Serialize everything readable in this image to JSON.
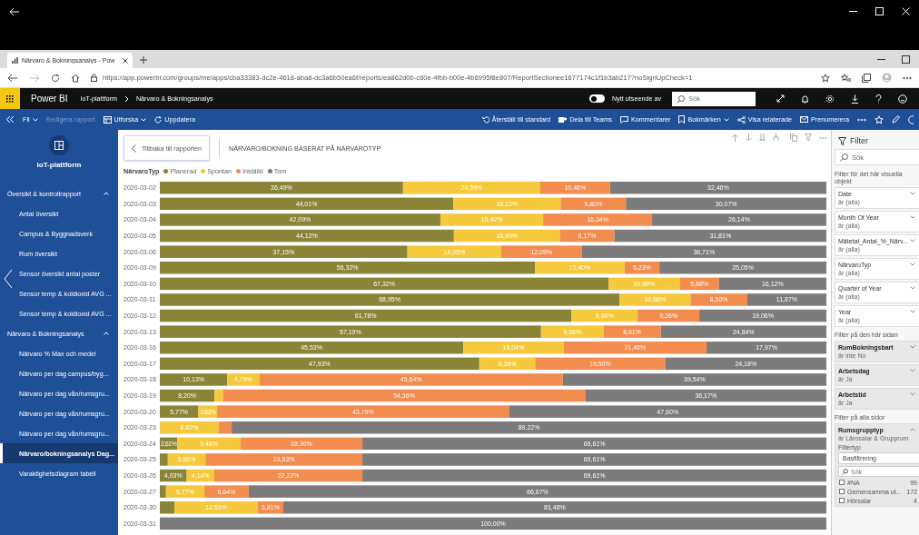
{
  "browser": {
    "tab": {
      "title": "Närvaro & Bokningsanalys - Pow"
    },
    "url": "https://app.powerbi.com/groups/me/apps/cba33383-dc2e-4618-aba8-dc3a6b50ea6f/reports/ea862d0b-c60e-4fbb-b00e-4b6995f8e807/ReportSectionee1677174c1f1b3ab217?noSignUpCheck=1"
  },
  "app_header": {
    "product": "Power BI",
    "breadcrumb": [
      "IoT-plattform",
      "Närvaro & Bokningsanalys"
    ],
    "toggle": {
      "label": "Nytt utseende av",
      "on": false
    },
    "search": {
      "placeholder": "Sök"
    }
  },
  "action_bar": {
    "left": [
      {
        "label": "Fil",
        "kind": "menu",
        "disabled": false
      },
      {
        "label": "Redigera rapport",
        "kind": "button",
        "disabled": true
      },
      {
        "label": "Utforska",
        "kind": "menu",
        "disabled": false
      },
      {
        "label": "Uppdatera",
        "kind": "button",
        "disabled": false
      }
    ],
    "right": [
      {
        "label": "Återställ till standard",
        "kind": "button",
        "disabled": false
      },
      {
        "label": "Dela till Teams",
        "kind": "button",
        "disabled": false
      },
      {
        "label": "Kommentarer",
        "kind": "button",
        "disabled": false
      },
      {
        "label": "Bokmärken",
        "kind": "menu",
        "disabled": false
      },
      {
        "label": "Visa relaterade",
        "kind": "button",
        "disabled": false
      },
      {
        "label": "Prenumerera",
        "kind": "button",
        "disabled": false
      }
    ]
  },
  "sidebar": {
    "workspace": "IoT-plattform",
    "sections": [
      {
        "title": "Översikt & kontrollrapport",
        "expanded": true,
        "children": [
          {
            "label": "Antal översikt",
            "selected": false
          },
          {
            "label": "Campus & Byggnadsverk",
            "selected": false
          },
          {
            "label": "Rum översikt",
            "selected": false
          },
          {
            "label": "Sensor översikt antal poster",
            "selected": false
          },
          {
            "label": "Sensor temp & koldioxid AVG ...",
            "selected": false
          },
          {
            "label": "Sensor temp & koldioxid AVG ...",
            "selected": false
          }
        ]
      },
      {
        "title": "Närvaro & Bokningsanalys",
        "expanded": true,
        "children": [
          {
            "label": "Närvaro % Max och medel",
            "selected": false
          },
          {
            "label": "Närvaro per dag campus/byg...",
            "selected": false
          },
          {
            "label": "Närvaro per dag vån/rumsgru...",
            "selected": false
          },
          {
            "label": "Närvaro per dag vån/rumsgru...",
            "selected": false
          },
          {
            "label": "Närvaro per dag vån/rumsgru...",
            "selected": false
          },
          {
            "label": "Närvaro/bokningsanalys Dag...",
            "selected": true
          },
          {
            "label": "Varaktighetsdiagram tabell",
            "selected": false
          }
        ]
      }
    ]
  },
  "report": {
    "back_button": "Tillbaka till rapporten",
    "legend_title": "NärvaroTyp",
    "chart_data": {
      "type": "bar",
      "orientation": "horizontal",
      "stacked": true,
      "title": "NÄRVARO/BOKNING BASERAT PÅ NÄRVAROTYP",
      "categories": [
        "2020-03-02",
        "2020-03-03",
        "2020-03-04",
        "2020-03-05",
        "2020-03-06",
        "2020-03-09",
        "2020-03-10",
        "2020-03-11",
        "2020-03-12",
        "2020-03-13",
        "2020-03-16",
        "2020-03-17",
        "2020-03-18",
        "2020-03-19",
        "2020-03-20",
        "2020-03-23",
        "2020-03-24",
        "2020-03-25",
        "2020-03-26",
        "2020-03-27",
        "2020-03-30",
        "2020-03-31"
      ],
      "series": [
        {
          "name": "Planerad",
          "color": "#8a8436",
          "values": [
            36.49,
            44.01,
            42.09,
            44.12,
            37.15,
            56.32,
            67.32,
            68.95,
            61.78,
            57.19,
            45.53,
            47.93,
            10.13,
            8.2,
            5.77,
            0,
            2.61,
            1.2,
            4.03,
            0.92,
            2.18,
            0
          ],
          "value_labels": [
            "36,49%",
            "44,01%",
            "42,09%",
            "44,12%",
            "37,15%",
            "56,32%",
            "67,32%",
            "68,95%",
            "61,78%",
            "57,19%",
            "45,53%",
            "47,93%",
            "10,13%",
            "8,20%",
            "5,77%",
            null,
            "2,61%",
            null,
            "4,03%",
            null,
            null,
            null
          ]
        },
        {
          "name": "Spontan",
          "color": "#f5c93b",
          "values": [
            20.59,
            16.12,
            15.42,
            15.9,
            14.05,
            13.4,
            10.68,
            10.68,
            9.9,
            9.36,
            15.04,
            8.39,
            4.79,
            1.27,
            2.83,
            8.82,
            9.48,
            5.66,
            4.14,
            5.77,
            12.53,
            0
          ],
          "value_labels": [
            "20,59%",
            "16,12%",
            "15,42%",
            "15,90%",
            "14,05%",
            "13,40%",
            "10,68%",
            "10,68%",
            "9,90%",
            "9,36%",
            "15,04%",
            "8,39%",
            "4,79%",
            null,
            "2,83%",
            "8,82%",
            "9,48%",
            "5,66%",
            "4,14%",
            "5,77%",
            "12,53%",
            null
          ]
        },
        {
          "name": "Inställd",
          "color": "#f28c4f",
          "values": [
            10.46,
            9.8,
            16.34,
            8.17,
            12.09,
            5.23,
            5.88,
            8.5,
            9.26,
            8.61,
            21.46,
            19.5,
            45.54,
            54.36,
            43.79,
            1.96,
            18.3,
            23.53,
            22.22,
            6.64,
            3.81,
            0
          ],
          "value_labels": [
            "10,46%",
            "9,80%",
            "16,34%",
            "8,17%",
            "12,09%",
            "5,23%",
            "5,88%",
            "8,50%",
            "9,26%",
            "8,61%",
            "21,46%",
            "19,50%",
            "45,54%",
            "54,36%",
            "43,79%",
            null,
            "18,30%",
            "23,53%",
            "22,22%",
            "6,64%",
            "3,81%",
            null
          ]
        },
        {
          "name": "Tom",
          "color": "#7b7b7b",
          "values": [
            32.46,
            30.07,
            26.14,
            31.81,
            36.71,
            25.05,
            16.12,
            11.87,
            19.06,
            24.84,
            17.97,
            24.18,
            39.54,
            36.17,
            47.6,
            89.22,
            69.61,
            69.61,
            69.61,
            86.67,
            81.48,
            100
          ],
          "value_labels": [
            "32,46%",
            "30,07%",
            "26,14%",
            "31,81%",
            "36,71%",
            "25,05%",
            "16,12%",
            "11,87%",
            "19,06%",
            "24,84%",
            "17,97%",
            "24,18%",
            "39,54%",
            "36,17%",
            "47,60%",
            "89,22%",
            "69,61%",
            "69,61%",
            "69,61%",
            "86,67%",
            "81,48%",
            "100,00%"
          ]
        }
      ]
    }
  },
  "filters": {
    "title": "Filter",
    "search": {
      "placeholder": "Sök"
    },
    "groups": [
      {
        "heading": "Filter för det här visuella objekt",
        "cards": [
          {
            "field": "Date",
            "condition": "är (alla)",
            "applied": false,
            "expanded": false
          },
          {
            "field": "Month Of Year",
            "condition": "är (alla)",
            "applied": false,
            "expanded": false
          },
          {
            "field": "Mätetal_Antal_%_Närv...",
            "condition": "är (alla)",
            "applied": false,
            "expanded": false
          },
          {
            "field": "NärvaroTyp",
            "condition": "är (alla)",
            "applied": false,
            "expanded": false
          },
          {
            "field": "Quarter of Year",
            "condition": "är (alla)",
            "applied": false,
            "expanded": false
          },
          {
            "field": "Year",
            "condition": "är (alla)",
            "applied": false,
            "expanded": false
          }
        ]
      },
      {
        "heading": "Filter på den här sidan",
        "cards": [
          {
            "field": "RumBokningsbart",
            "condition": "är inte No",
            "applied": true,
            "expanded": false
          },
          {
            "field": "Arbetsdag",
            "condition": "är Ja",
            "applied": true,
            "expanded": false
          },
          {
            "field": "Arbetstid",
            "condition": "är Ja",
            "applied": true,
            "expanded": false
          }
        ]
      },
      {
        "heading": "Filter på alla sidor",
        "cards": [
          {
            "field": "Rumsgrupptyp",
            "condition": "är Lärosalar & Grupprum",
            "applied": true,
            "expanded": true,
            "filter_type_label": "Filtertyp",
            "filter_type": "Basfiltrering",
            "search_placeholder": "Sök",
            "options": [
              {
                "label": "#NA",
                "count": "99",
                "checked": false
              },
              {
                "label": "Gemensamma ut...",
                "count": "172",
                "checked": false
              },
              {
                "label": "Hörsalar",
                "count": "4",
                "checked": false
              }
            ]
          }
        ]
      }
    ]
  }
}
